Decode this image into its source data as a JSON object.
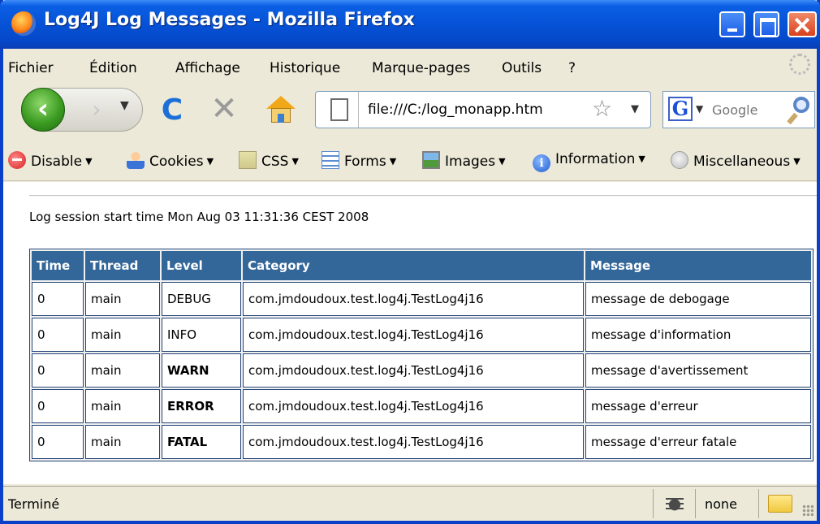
{
  "window": {
    "title": "Log4J Log Messages - Mozilla Firefox"
  },
  "menu": {
    "items": [
      "Fichier",
      "Édition",
      "Affichage",
      "Historique",
      "Marque-pages",
      "Outils",
      "?"
    ]
  },
  "navigation": {
    "url": "file:///C:/log_monapp.htm",
    "search_placeholder": "Google"
  },
  "devtoolbar": {
    "items": [
      "Disable",
      "Cookies",
      "CSS",
      "Forms",
      "Images",
      "Information",
      "Miscellaneous"
    ]
  },
  "page": {
    "session_text": "Log session start time Mon Aug 03 11:31:36 CEST 2008",
    "table": {
      "headers": [
        "Time",
        "Thread",
        "Level",
        "Category",
        "Message"
      ],
      "rows": [
        [
          "0",
          "main",
          "DEBUG",
          "com.jmdoudoux.test.log4j.TestLog4j16",
          "message de debogage"
        ],
        [
          "0",
          "main",
          "INFO",
          "com.jmdoudoux.test.log4j.TestLog4j16",
          "message d'information"
        ],
        [
          "0",
          "main",
          "WARN",
          "com.jmdoudoux.test.log4j.TestLog4j16",
          "message d'avertissement"
        ],
        [
          "0",
          "main",
          "ERROR",
          "com.jmdoudoux.test.log4j.TestLog4j16",
          "message d'erreur"
        ],
        [
          "0",
          "main",
          "FATAL",
          "com.jmdoudoux.test.log4j.TestLog4j16",
          "message d'erreur fatale"
        ]
      ]
    }
  },
  "status": {
    "text": "Terminé",
    "zone": "none"
  },
  "colors": {
    "header_bg": "#336699",
    "debug": "#339933",
    "warn_error_fatal": "#993300",
    "title_bar": "#0652d6"
  },
  "icons": [
    "firefox-logo-icon",
    "minimize-icon",
    "maximize-icon",
    "close-icon",
    "back-arrow-icon",
    "forward-arrow-icon",
    "reload-icon",
    "stop-icon",
    "home-icon",
    "page-icon",
    "bookmark-star-icon",
    "google-icon",
    "search-icon",
    "disable-icon",
    "cookies-icon",
    "css-icon",
    "forms-icon",
    "images-icon",
    "information-icon",
    "miscellaneous-icon",
    "firebug-icon",
    "folder-icon"
  ]
}
